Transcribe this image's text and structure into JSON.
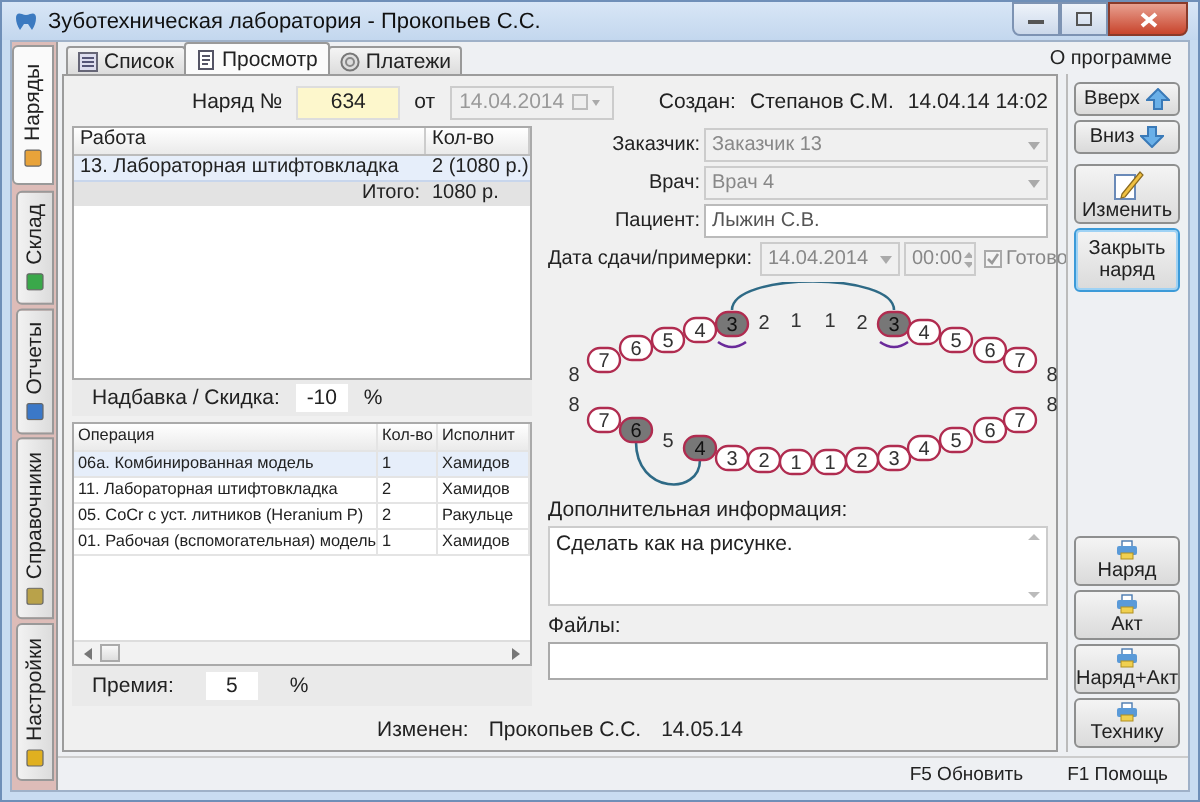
{
  "window": {
    "title": "Зуботехническая лаборатория - Прокопьев С.С."
  },
  "side_tabs": [
    {
      "label": "Наряды",
      "selected": true,
      "kind": "orders"
    },
    {
      "label": "Склад",
      "selected": false,
      "kind": "stock"
    },
    {
      "label": "Отчеты",
      "selected": false,
      "kind": "reports"
    },
    {
      "label": "Справочники",
      "selected": false,
      "kind": "books"
    },
    {
      "label": "Настройки",
      "selected": false,
      "kind": "settings"
    }
  ],
  "tabs": [
    {
      "label": "Список",
      "selected": false,
      "kind": "list"
    },
    {
      "label": "Просмотр",
      "selected": true,
      "kind": "view"
    },
    {
      "label": "Платежи",
      "selected": false,
      "kind": "payments"
    }
  ],
  "about_link": "О программе",
  "order": {
    "number_label": "Наряд №",
    "number": "634",
    "date_label": "от",
    "date": "14.04.2014",
    "created_label": "Создан:",
    "created_by": "Степанов С.М.",
    "created_at": "14.04.14 14:02"
  },
  "works_table": {
    "columns": [
      "Работа",
      "Кол-во"
    ],
    "rows": [
      {
        "cells": [
          "13. Лабораторная штифтовкладка",
          "2 (1080 р.)"
        ],
        "selected": true
      }
    ],
    "total_label": "Итого:",
    "total": "1080 р."
  },
  "markup": {
    "label": "Надбавка / Скидка:",
    "value": "-10",
    "unit": "%"
  },
  "operations_table": {
    "columns": [
      "Операция",
      "Кол-во",
      "Исполнит"
    ],
    "rows": [
      {
        "cells": [
          "06а. Комбинированная модель",
          "1",
          "Хамидов"
        ],
        "selected": true
      },
      {
        "cells": [
          "11. Лабораторная штифтовкладка",
          "2",
          "Хамидов"
        ],
        "selected": false
      },
      {
        "cells": [
          "05. CoCr с уст. литников (Heranium P)",
          "2",
          "Ракульце"
        ],
        "selected": false
      },
      {
        "cells": [
          "01. Рабочая (вспомогательная) модель",
          "1",
          "Хамидов"
        ],
        "selected": false
      }
    ]
  },
  "bonus": {
    "label": "Премия:",
    "value": "5",
    "unit": "%"
  },
  "modified": {
    "label": "Изменен:",
    "by": "Прокопьев С.С.",
    "date": "14.05.14"
  },
  "fields": [
    {
      "kind": "combo",
      "label": "Заказчик:",
      "value": "Заказчик 13",
      "disabled": true
    },
    {
      "kind": "combo",
      "label": "Врач:",
      "value": "Врач 4",
      "disabled": true
    },
    {
      "kind": "text",
      "label": "Пациент:",
      "value": "Лыжин С.В.",
      "disabled": false
    }
  ],
  "delivery": {
    "label": "Дата сдачи/примерки:",
    "date": "14.04.2014",
    "time": "00:00",
    "ready_label": "Готово",
    "ready": true
  },
  "teeth": {
    "upper": [
      {
        "label": "8",
        "kind": "missing",
        "clasp": false
      },
      {
        "label": "7",
        "kind": "tooth",
        "clasp": false
      },
      {
        "label": "6",
        "kind": "tooth",
        "clasp": false
      },
      {
        "label": "5",
        "kind": "tooth",
        "clasp": false
      },
      {
        "label": "4",
        "kind": "tooth",
        "clasp": false
      },
      {
        "label": "3",
        "kind": "crown",
        "clasp": true
      },
      {
        "label": "2",
        "kind": "missing",
        "clasp": false
      },
      {
        "label": "1",
        "kind": "missing",
        "clasp": false
      },
      {
        "label": "1",
        "kind": "missing",
        "clasp": false
      },
      {
        "label": "2",
        "kind": "missing",
        "clasp": false
      },
      {
        "label": "3",
        "kind": "crown",
        "clasp": true
      },
      {
        "label": "4",
        "kind": "tooth",
        "clasp": false
      },
      {
        "label": "5",
        "kind": "tooth",
        "clasp": false
      },
      {
        "label": "6",
        "kind": "tooth",
        "clasp": false
      },
      {
        "label": "7",
        "kind": "tooth",
        "clasp": false
      },
      {
        "label": "8",
        "kind": "missing",
        "clasp": false
      }
    ],
    "lower": [
      {
        "label": "8",
        "kind": "missing",
        "clasp": false
      },
      {
        "label": "7",
        "kind": "tooth",
        "clasp": false
      },
      {
        "label": "6",
        "kind": "crown",
        "clasp": false
      },
      {
        "label": "5",
        "kind": "missing",
        "clasp": false
      },
      {
        "label": "4",
        "kind": "crown",
        "clasp": false
      },
      {
        "label": "3",
        "kind": "tooth",
        "clasp": false
      },
      {
        "label": "2",
        "kind": "tooth",
        "clasp": false
      },
      {
        "label": "1",
        "kind": "tooth",
        "clasp": false
      },
      {
        "label": "1",
        "kind": "tooth",
        "clasp": false
      },
      {
        "label": "2",
        "kind": "tooth",
        "clasp": false
      },
      {
        "label": "3",
        "kind": "tooth",
        "clasp": false
      },
      {
        "label": "4",
        "kind": "tooth",
        "clasp": false
      },
      {
        "label": "5",
        "kind": "tooth",
        "clasp": false
      },
      {
        "label": "6",
        "kind": "tooth",
        "clasp": false
      },
      {
        "label": "7",
        "kind": "tooth",
        "clasp": false
      },
      {
        "label": "8",
        "kind": "missing",
        "clasp": false
      }
    ]
  },
  "notes": {
    "label": "Дополнительная информация:",
    "value": "Сделать как на рисунке."
  },
  "files": {
    "label": "Файлы:"
  },
  "action_buttons": [
    {
      "label": "Вверх",
      "kind": "up",
      "focused": false
    },
    {
      "label": "Вниз",
      "kind": "down",
      "focused": false
    },
    {
      "label": "Изменить",
      "kind": "edit",
      "focused": false
    },
    {
      "label": "Закрыть наряд",
      "kind": "plain",
      "focused": true
    }
  ],
  "print_buttons": [
    "Наряд",
    "Акт",
    "Наряд+Акт",
    "Технику"
  ],
  "status_bar": [
    "F5 Обновить",
    "F1 Помощь"
  ]
}
